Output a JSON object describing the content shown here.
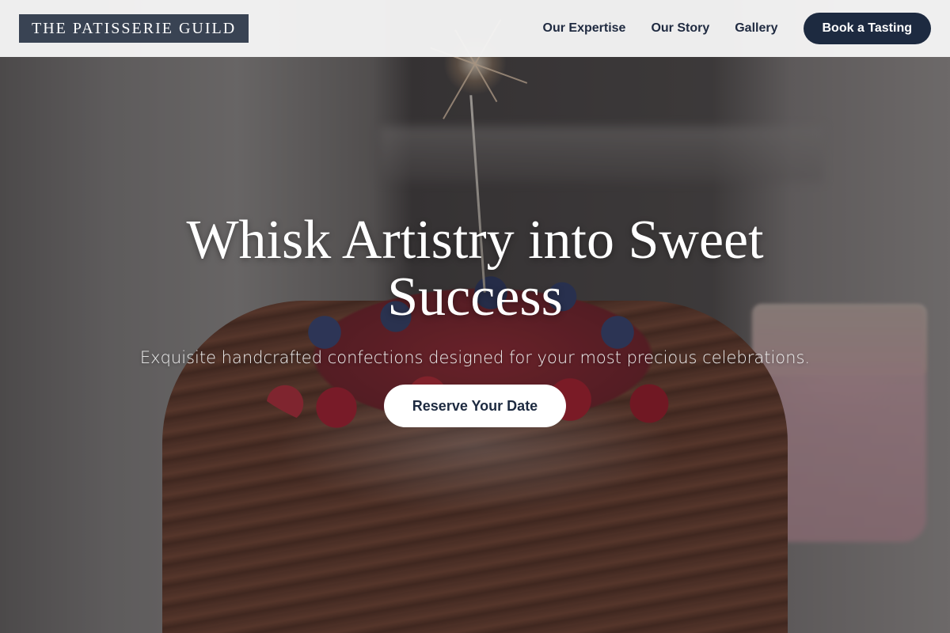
{
  "header": {
    "brand": "THE PATISSERIE GUILD",
    "nav": [
      {
        "label": "Our Expertise"
      },
      {
        "label": "Our Story"
      },
      {
        "label": "Gallery"
      }
    ],
    "cta_label": "Book a Tasting"
  },
  "hero": {
    "title": "Whisk Artistry into Sweet Success",
    "subtitle": "Exquisite handcrafted confections designed for your most precious celebrations.",
    "cta_label": "Reserve Your Date",
    "background_image": "chocolate-cake-with-berries-and-sparkler"
  },
  "colors": {
    "brand_bg": "#394353",
    "primary": "#1d2a40",
    "header_bg": "#f5f5f5",
    "hero_text": "#ffffff"
  }
}
